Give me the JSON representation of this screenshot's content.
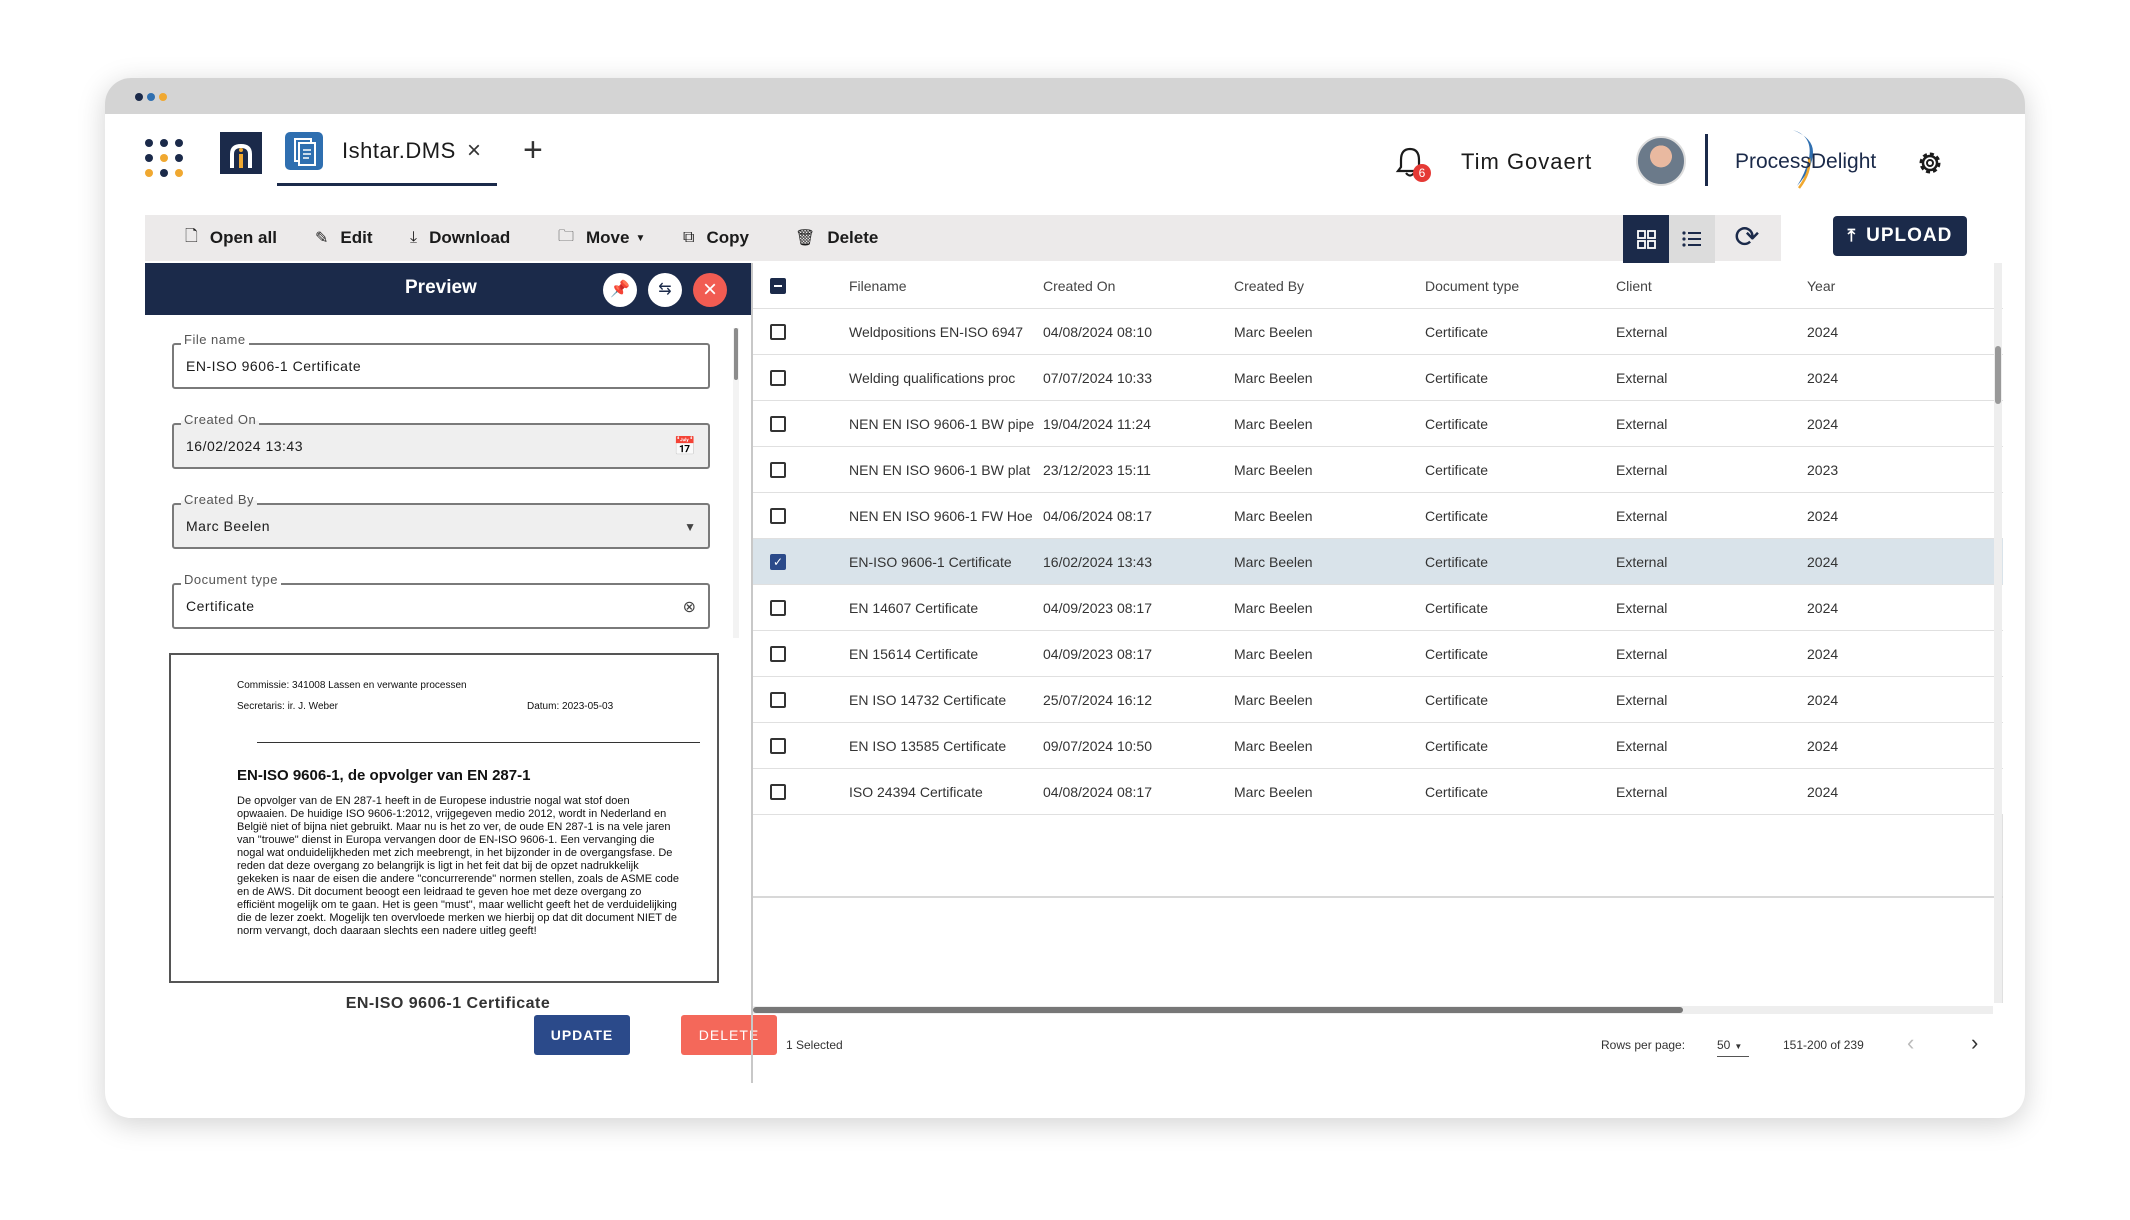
{
  "window": {
    "dots": [
      "#1b2a4a",
      "#2f6fb0",
      "#f0a830"
    ]
  },
  "header": {
    "tab_label": "Ishtar.DMS",
    "tab_close": "×",
    "tab_add": "+",
    "notification_count": "6",
    "user_name": "Tim Govaert",
    "brand_name": "ProcessDelight"
  },
  "toolbar": {
    "open_all": "Open all",
    "edit": "Edit",
    "download": "Download",
    "move": "Move",
    "copy": "Copy",
    "delete": "Delete",
    "upload": "UPLOAD"
  },
  "preview": {
    "title": "Preview",
    "fields": {
      "file_name": {
        "label": "File name",
        "value": "EN-ISO 9606-1 Certificate"
      },
      "created_on": {
        "label": "Created On",
        "value": "16/02/2024 13:43"
      },
      "created_by": {
        "label": "Created By",
        "value": "Marc Beelen"
      },
      "document_type": {
        "label": "Document type",
        "value": "Certificate"
      }
    },
    "doc": {
      "commissie": "Commissie: 341008 Lassen en verwante processen",
      "secretaris": "Secretaris: ir. J. Weber",
      "datum": "Datum: 2023-05-03",
      "heading": "EN-ISO 9606-1, de opvolger van EN 287-1",
      "body": "De opvolger van de EN 287-1 heeft in de Europese industrie nogal wat stof doen opwaaien. De huidige ISO 9606-1:2012, vrijgegeven medio 2012, wordt in Nederland en België niet of bijna niet gebruikt. Maar nu is het zo ver, de oude EN 287-1 is na vele jaren van \"trouwe\" dienst in Europa vervangen door de EN-ISO 9606-1. Een vervanging die nogal wat onduidelijkheden met zich meebrengt, in het bijzonder in de overgangsfase. De reden dat deze overgang zo belangrijk is ligt in het feit dat bij de opzet nadrukkelijk gekeken is naar de eisen die andere \"concurrerende\" normen stellen, zoals de ASME code en de AWS. Dit document beoogt een leidraad te geven hoe met deze overgang zo efficiënt mogelijk om te gaan. Het is geen \"must\", maar wellicht geeft het de verduidelijking die de lezer zoekt. Mogelijk ten overvloede merken we hierbij op dat dit document NIET de norm vervangt, doch daaraan slechts een nadere uitleg geeft!"
    },
    "caption": "EN-ISO 9606-1 Certificate",
    "update_label": "UPDATE",
    "delete_label": "DELETE"
  },
  "table": {
    "columns": [
      "Filename",
      "Created On",
      "Created By",
      "Document type",
      "Client",
      "Year"
    ],
    "rows": [
      {
        "filename": "Weldpositions EN-ISO 6947",
        "created_on": "04/08/2024 08:10",
        "created_by": "Marc Beelen",
        "doc_type": "Certificate",
        "client": "External",
        "year": "2024",
        "selected": false
      },
      {
        "filename": "Welding qualifications proc",
        "created_on": "07/07/2024 10:33",
        "created_by": "Marc Beelen",
        "doc_type": "Certificate",
        "client": "External",
        "year": "2024",
        "selected": false
      },
      {
        "filename": "NEN EN ISO 9606-1 BW pipe",
        "created_on": "19/04/2024 11:24",
        "created_by": "Marc Beelen",
        "doc_type": "Certificate",
        "client": "External",
        "year": "2024",
        "selected": false
      },
      {
        "filename": "NEN EN ISO 9606-1 BW plat",
        "created_on": "23/12/2023 15:11",
        "created_by": "Marc Beelen",
        "doc_type": "Certificate",
        "client": "External",
        "year": "2023",
        "selected": false
      },
      {
        "filename": "NEN EN ISO 9606-1 FW Hoe",
        "created_on": "04/06/2024 08:17",
        "created_by": "Marc Beelen",
        "doc_type": "Certificate",
        "client": "External",
        "year": "2024",
        "selected": false
      },
      {
        "filename": "EN-ISO 9606-1 Certificate",
        "created_on": "16/02/2024 13:43",
        "created_by": "Marc Beelen",
        "doc_type": "Certificate",
        "client": "External",
        "year": "2024",
        "selected": true
      },
      {
        "filename": "EN 14607 Certificate",
        "created_on": "04/09/2023 08:17",
        "created_by": "Marc Beelen",
        "doc_type": "Certificate",
        "client": "External",
        "year": "2024",
        "selected": false
      },
      {
        "filename": "EN 15614 Certificate",
        "created_on": "04/09/2023 08:17",
        "created_by": "Marc Beelen",
        "doc_type": "Certificate",
        "client": "External",
        "year": "2024",
        "selected": false
      },
      {
        "filename": "EN ISO 14732 Certificate",
        "created_on": "25/07/2024 16:12",
        "created_by": "Marc Beelen",
        "doc_type": "Certificate",
        "client": "External",
        "year": "2024",
        "selected": false
      },
      {
        "filename": "EN ISO 13585 Certificate",
        "created_on": "09/07/2024 10:50",
        "created_by": "Marc Beelen",
        "doc_type": "Certificate",
        "client": "External",
        "year": "2024",
        "selected": false
      },
      {
        "filename": "ISO 24394 Certificate",
        "created_on": "04/08/2024 08:17",
        "created_by": "Marc Beelen",
        "doc_type": "Certificate",
        "client": "External",
        "year": "2024",
        "selected": false
      }
    ]
  },
  "footer": {
    "selected_text": "1 Selected",
    "rows_per_page_label": "Rows per page:",
    "rows_per_page_value": "50",
    "range": "151-200 of 239"
  },
  "colors": {
    "primary": "#1b2a4a",
    "selected_row": "#d9e3ea",
    "danger": "#f4685a",
    "update": "#2b4a8a"
  }
}
